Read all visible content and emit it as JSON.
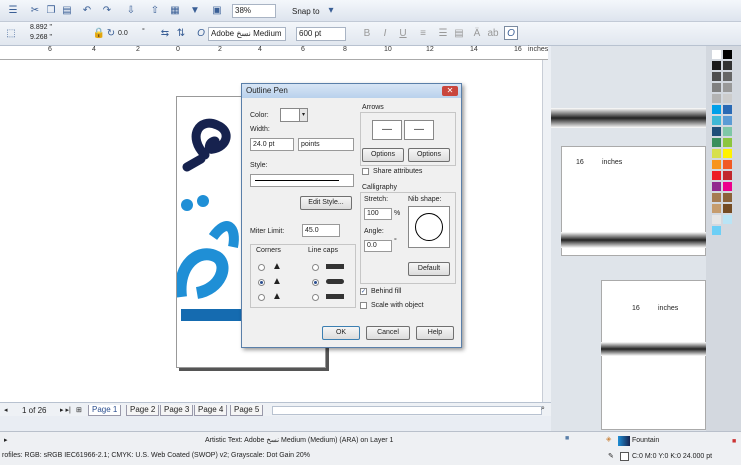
{
  "toolbar1": {
    "zoom": "38%",
    "snap": "Snap to"
  },
  "toolbar2": {
    "x": "8.892 \"",
    "y": "9.268 \"",
    "angle": "0.0",
    "angle_unit": "°",
    "font": "Adobe نسخ Medium",
    "size": "600 pt"
  },
  "ruler": {
    "ticks": [
      "6",
      "4",
      "2",
      "0",
      "2",
      "4",
      "6",
      "8",
      "10",
      "12",
      "14",
      "16"
    ],
    "unit": "inches"
  },
  "dialog": {
    "title": "Outline Pen",
    "color_label": "Color:",
    "width_label": "Width:",
    "width_value": "24.0 pt",
    "width_unit": "points",
    "style_label": "Style:",
    "edit_style": "Edit Style...",
    "miter_label": "Miter Limit:",
    "miter_value": "45.0",
    "corners_label": "Corners",
    "linecaps_label": "Line caps",
    "arrows_label": "Arrows",
    "options1": "Options",
    "options2": "Options",
    "share_attributes": "Share attributes",
    "calligraphy_label": "Calligraphy",
    "stretch_label": "Stretch:",
    "stretch_value": "100",
    "stretch_unit": "%",
    "nib_label": "Nib shape:",
    "angle_label": "Angle:",
    "angle_value": "0.0",
    "angle_unit": "°",
    "default_btn": "Default",
    "behind_fill": "Behind fill",
    "behind_fill_checked": true,
    "scale_with_object": "Scale with object",
    "ok": "OK",
    "cancel": "Cancel",
    "help": "Help"
  },
  "docker": {
    "ruler_16": "16",
    "ruler_unit": "inches"
  },
  "pages": {
    "counter": "1 of 26",
    "tabs": [
      "Page 1",
      "Page 2",
      "Page 3",
      "Page 4",
      "Page 5"
    ]
  },
  "status": {
    "object_info": "Artistic Text: Adobe نسخ Medium (Medium) (ARA) on Layer 1",
    "profiles": "rofiles: RGB: sRGB IEC61966-2.1; CMYK: U.S. Web Coated (SWOP) v2; Grayscale: Dot Gain 20%",
    "fill_label": "Fountain",
    "outline_info": "C:0 M:0 Y:0 K:0  24.000 pt"
  },
  "colors": {
    "accent": "#1f8fd6",
    "dark_glyph": "#16224e"
  }
}
